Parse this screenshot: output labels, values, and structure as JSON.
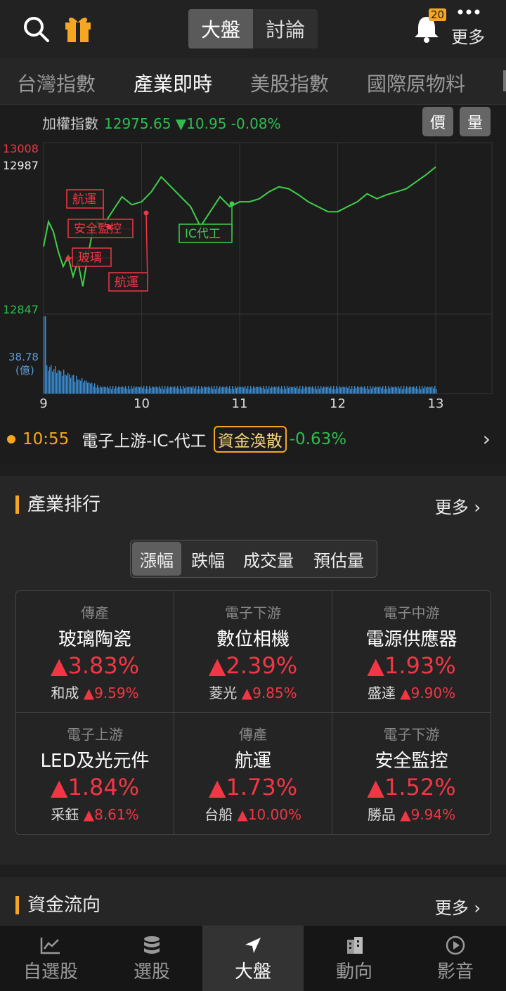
{
  "header": {
    "seg": [
      "大盤",
      "討論"
    ],
    "notif_count": "20",
    "more_label": "更多"
  },
  "tabs": [
    "台灣指數",
    "產業即時",
    "美股指數",
    "國際原物料"
  ],
  "index": {
    "name": "加權指數",
    "value": "12975.65 ▼10.95 -0.08%",
    "btn_price": "價",
    "btn_volume": "量"
  },
  "chart_data": {
    "type": "line",
    "y_ticks": [
      "13008",
      "12987",
      "12847"
    ],
    "volume_tick": "38.78",
    "volume_unit": "(億)",
    "x_ticks": [
      "9",
      "10",
      "11",
      "12",
      "13"
    ],
    "annotations": [
      "航運",
      "安全監控",
      "玻璃",
      "航運",
      "IC代工"
    ],
    "series": [
      {
        "x": [
          9.0,
          9.05,
          9.1,
          9.15,
          9.2,
          9.25,
          9.3,
          9.35,
          9.4,
          9.45,
          9.5,
          9.55,
          9.6,
          9.7,
          9.8,
          9.9,
          10.0,
          10.1,
          10.2,
          10.3,
          10.4,
          10.5,
          10.6,
          10.7,
          10.8,
          10.9,
          11.0,
          11.1,
          11.2,
          11.3,
          11.4,
          11.5,
          11.6,
          11.7,
          11.8,
          11.9,
          12.0,
          12.1,
          12.2,
          12.3,
          12.4,
          12.5,
          12.6,
          12.7,
          12.8,
          12.9,
          13.0
        ],
        "values": [
          12910,
          12935,
          12925,
          12905,
          12890,
          12900,
          12880,
          12895,
          12870,
          12900,
          12925,
          12935,
          12930,
          12945,
          12960,
          12952,
          12955,
          12965,
          12980,
          12970,
          12960,
          12950,
          12930,
          12945,
          12960,
          12950,
          12955,
          12955,
          12958,
          12965,
          12970,
          12968,
          12962,
          12955,
          12950,
          12945,
          12945,
          12950,
          12955,
          12963,
          12958,
          12962,
          12965,
          12968,
          12975,
          12982,
          12990
        ]
      }
    ]
  },
  "flash": {
    "time": "10:55",
    "title": "電子上游-IC-代工",
    "tag": "資金渙散",
    "change": "-0.63%"
  },
  "ranking": {
    "title": "產業排行",
    "more": "更多",
    "seg": [
      "漲幅",
      "跌幅",
      "成交量",
      "預估量"
    ],
    "cells": [
      {
        "cat": "傳產",
        "name": "玻璃陶瓷",
        "pct": "▲3.83%",
        "stock": "和成",
        "stock_pct": "▲9.59%"
      },
      {
        "cat": "電子下游",
        "name": "數位相機",
        "pct": "▲2.39%",
        "stock": "菱光",
        "stock_pct": "▲9.85%"
      },
      {
        "cat": "電子中游",
        "name": "電源供應器",
        "pct": "▲1.93%",
        "stock": "盛達",
        "stock_pct": "▲9.90%"
      },
      {
        "cat": "電子上游",
        "name": "LED及光元件",
        "pct": "▲1.84%",
        "stock": "采鈺",
        "stock_pct": "▲8.61%"
      },
      {
        "cat": "傳產",
        "name": "航運",
        "pct": "▲1.73%",
        "stock": "台船",
        "stock_pct": "▲10.00%"
      },
      {
        "cat": "電子下游",
        "name": "安全監控",
        "pct": "▲1.52%",
        "stock": "勝品",
        "stock_pct": "▲9.94%"
      }
    ]
  },
  "funds": {
    "title": "資金流向",
    "more": "更多"
  },
  "nav": [
    "自選股",
    "選股",
    "大盤",
    "動向",
    "影音"
  ],
  "colors": {
    "up": "#f23645",
    "down": "#2ebd4e",
    "accent": "#f5a623"
  }
}
